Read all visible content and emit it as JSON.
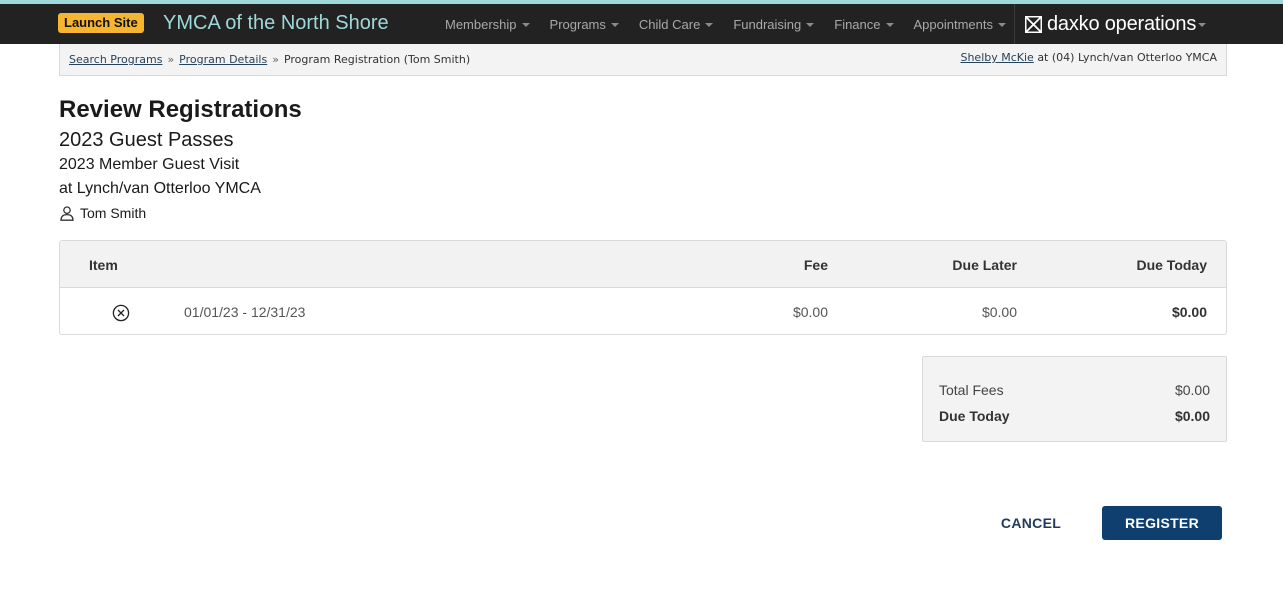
{
  "header": {
    "launch_label": "Launch Site",
    "site_title": "YMCA of the North Shore",
    "nav": [
      {
        "label": "Membership"
      },
      {
        "label": "Programs"
      },
      {
        "label": "Child Care"
      },
      {
        "label": "Fundraising"
      },
      {
        "label": "Finance"
      },
      {
        "label": "Appointments"
      }
    ],
    "brand_text": "daxko operations"
  },
  "breadcrumb": {
    "items": [
      {
        "label": "Search Programs",
        "link": true
      },
      {
        "label": "Program Details",
        "link": true
      },
      {
        "label": "Program Registration (Tom Smith)",
        "link": false
      }
    ],
    "separator": "»",
    "user_name": "Shelby McKie",
    "user_location": "at (04) Lynch/van Otterloo YMCA"
  },
  "page": {
    "title": "Review Registrations",
    "program": "2023 Guest Passes",
    "offering": "2023 Member Guest Visit",
    "location": "at Lynch/van Otterloo YMCA",
    "person": "Tom Smith"
  },
  "table": {
    "headers": {
      "item": "Item",
      "fee": "Fee",
      "due_later": "Due Later",
      "due_today": "Due Today"
    },
    "rows": [
      {
        "dates": "01/01/23 - 12/31/23",
        "fee": "$0.00",
        "due_later": "$0.00",
        "due_today": "$0.00"
      }
    ]
  },
  "summary": {
    "total_fees_label": "Total Fees",
    "total_fees_value": "$0.00",
    "due_today_label": "Due Today",
    "due_today_value": "$0.00"
  },
  "actions": {
    "cancel_label": "CANCEL",
    "register_label": "REGISTER"
  },
  "colors": {
    "topbar": "#222222",
    "accent_teal": "#9fd8d8",
    "launch_yellow": "#f5b52e",
    "primary_button": "#0f3f6e"
  }
}
